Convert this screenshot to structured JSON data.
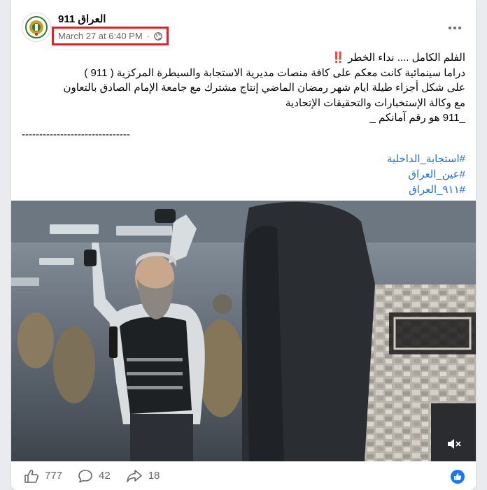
{
  "post": {
    "page_name": "العراق 911",
    "timestamp": "March 27 at 6:40 PM",
    "privacy_icon": "globe-icon",
    "more_icon": "more-options-icon",
    "text_lines": [
      "الفلم الكامل  .... نداء الخطر ‼️",
      "دراما سينمائية كانت معكم  على كافة منصات مديرية الاستجابة والسيطرة المركزية ( 911 )",
      "على شكل أجزاء طيلة ايام شهر رمضان الماضي  إنتاج مشترك مع جامعة الإمام الصادق بالتعاون",
      "مع وكالة الإستخبارات والتحقيقات الإتحادية",
      "_911 هو رقم آمانكم _"
    ],
    "separator": "-------------------------------",
    "hashtags": [
      "#استجابة_الداخلية",
      "#عين_العراق",
      "#٩١١_العراق"
    ]
  },
  "video": {
    "mute_icon": "speaker-muted-icon"
  },
  "actions": {
    "likes": "777",
    "comments": "42",
    "shares": "18",
    "like_icon": "thumbs-up-icon",
    "comment_icon": "comment-bubble-icon",
    "share_icon": "share-arrow-icon",
    "reaction_icon": "like-reaction-icon"
  },
  "colors": {
    "highlight_border": "#e0202a",
    "link": "#216fdb",
    "reaction_blue": "#1877f2",
    "muted_text": "#65676b"
  }
}
